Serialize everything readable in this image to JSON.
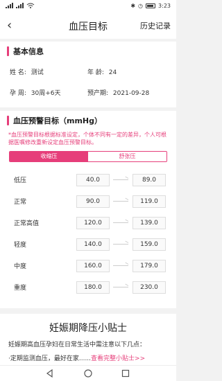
{
  "status_bar": {
    "left": "ᯤ 4G ᯤ",
    "time": "3:23",
    "icons": [
      "signal-icon",
      "wifi-icon",
      "bluetooth-icon",
      "alarm-icon",
      "battery-icon"
    ]
  },
  "header": {
    "title": "血压目标",
    "right_action": "历史记录"
  },
  "basic_info": {
    "section_title": "基本信息",
    "name_label": "姓    名:",
    "name_value": "测试",
    "age_label": "年    龄:",
    "age_value": "24",
    "pregnancy_label": "孕    周:",
    "pregnancy_value": "30周+6天",
    "due_label": "预产期:",
    "due_value": "2021-09-28"
  },
  "target": {
    "section_title": "血压预警目标（mmHg）",
    "notice": "*血压预警目标根据标准设定，个体不同有一定的差异，个人可根据医嘱修改重新设定血压预警目标。",
    "tabs": [
      {
        "label": "收缩压",
        "active": true
      },
      {
        "label": "舒张压",
        "active": false
      }
    ],
    "rows": [
      {
        "label": "低压",
        "low": "40.0",
        "high": "89.0"
      },
      {
        "label": "正常",
        "low": "90.0",
        "high": "119.0"
      },
      {
        "label": "正常高值",
        "low": "120.0",
        "high": "139.0"
      },
      {
        "label": "轻度",
        "low": "140.0",
        "high": "159.0"
      },
      {
        "label": "中度",
        "low": "160.0",
        "high": "179.0"
      },
      {
        "label": "重度",
        "low": "180.0",
        "high": "230.0"
      }
    ]
  },
  "tips": {
    "title": "妊娠期降压小贴士",
    "line1": "妊娠期高血压孕妇在日常生活中需注意以下几点：",
    "line2_prefix": "·定期监测血压，最好在家......",
    "line2_link": "查看完整小贴士>>"
  },
  "colors": {
    "accent": "#e63e7a"
  }
}
